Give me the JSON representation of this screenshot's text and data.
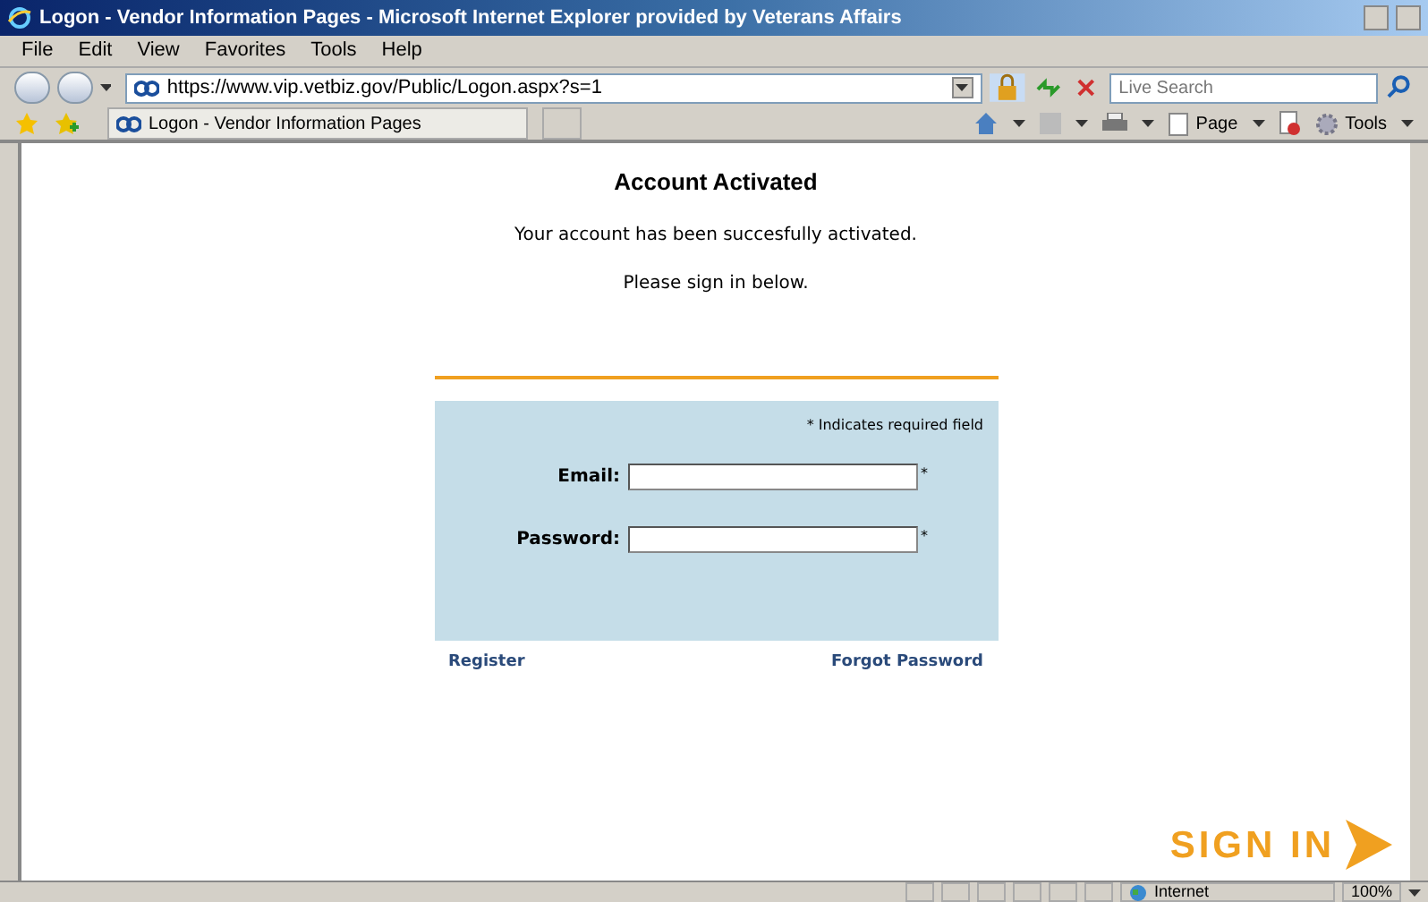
{
  "window": {
    "title": "Logon - Vendor Information Pages - Microsoft Internet Explorer provided by Veterans Affairs"
  },
  "menu": [
    "File",
    "Edit",
    "View",
    "Favorites",
    "Tools",
    "Help"
  ],
  "address": {
    "value": "https://www.vip.vetbiz.gov/Public/Logon.aspx?s=1"
  },
  "search": {
    "placeholder": "Live Search"
  },
  "tab": {
    "label": "Logon - Vendor Information Pages"
  },
  "command_bar": [
    "Page",
    "Tools"
  ],
  "page": {
    "heading": "Account Activated",
    "message": "Your account has been succesfully activated.",
    "instruction": "Please sign in below.",
    "form": {
      "note": "* Indicates required field",
      "fields": [
        {
          "label": "Email:",
          "required_mark": "*"
        },
        {
          "label": "Password:",
          "required_mark": "*"
        }
      ]
    },
    "links": [
      "Register",
      "Forgot Password"
    ],
    "sign_in": "SIGN IN"
  },
  "status_bar": {
    "zone": "Internet",
    "zoom": "100%"
  }
}
